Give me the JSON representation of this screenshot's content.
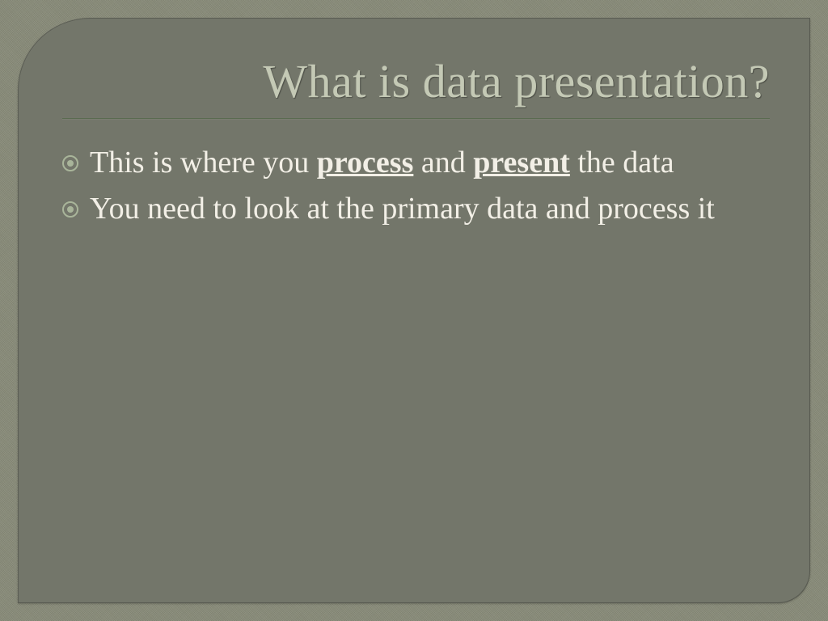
{
  "slide": {
    "title": "What is data presentation?",
    "bullets": [
      {
        "seg1": "This is where you ",
        "strong1": "process",
        "seg2": " and ",
        "strong2": "present",
        "seg3": " the data"
      },
      {
        "text": "You need to look at the primary data and process it"
      }
    ]
  }
}
